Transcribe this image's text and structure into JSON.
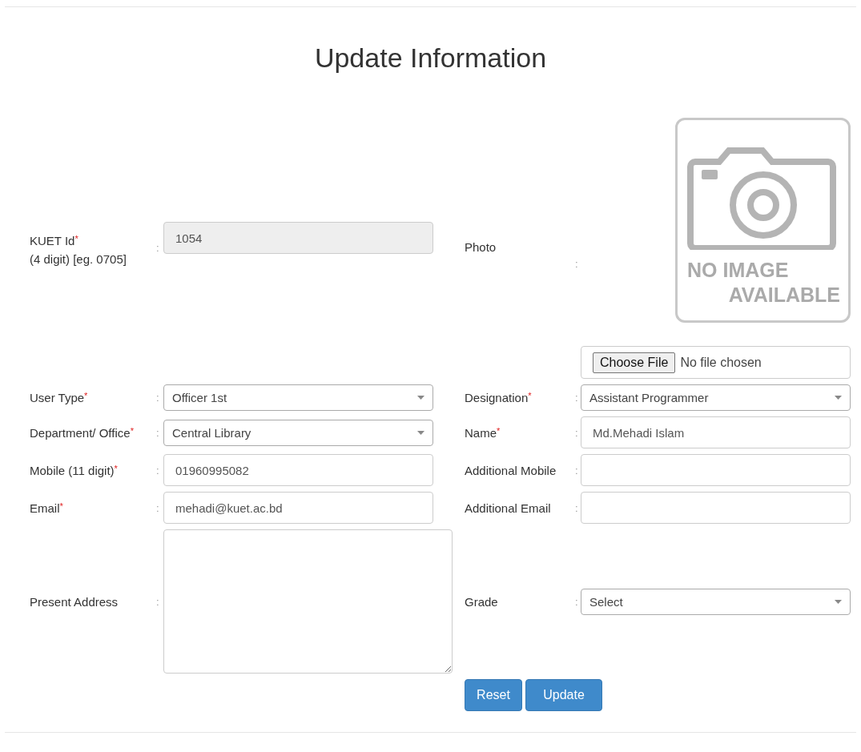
{
  "title": "Update Information",
  "rows": [
    {
      "left": {
        "kind": "text",
        "label": "KUET Id",
        "marker": "*",
        "hint": "(4 digit) [eg. 0705]",
        "separator": ":",
        "value": "1054",
        "disabled": true
      },
      "right": {
        "kind": "photo",
        "label": "Photo",
        "separator": ":",
        "image_text": [
          "NO IMAGE",
          "AVAILABLE"
        ]
      }
    },
    {
      "right": {
        "kind": "file",
        "button": "Choose File",
        "status": "No file chosen"
      }
    },
    {
      "left": {
        "kind": "select",
        "label": "User Type",
        "marker": "*",
        "separator": ":",
        "value": "Officer 1st"
      },
      "right": {
        "kind": "select",
        "label": "Designation",
        "marker": "*",
        "separator": ":",
        "value": "Assistant Programmer"
      }
    },
    {
      "left": {
        "kind": "select",
        "label": "Department/ Office",
        "marker": "*",
        "separator": ":",
        "value": "Central Library"
      },
      "right": {
        "kind": "text",
        "label": "Name",
        "marker": "*",
        "separator": ":",
        "value": "Md.Mehadi Islam",
        "disabled": false
      }
    },
    {
      "left": {
        "kind": "text",
        "label": "Mobile (11 digit)",
        "marker": "*",
        "separator": ":",
        "value": "01960995082",
        "disabled": false
      },
      "right": {
        "kind": "text",
        "label": "Additional Mobile",
        "separator": ":",
        "disabled": false
      }
    },
    {
      "left": {
        "kind": "text",
        "label": "Email",
        "marker": "*",
        "separator": ":",
        "value": "mehadi@kuet.ac.bd",
        "disabled": false
      },
      "right": {
        "kind": "text",
        "label": "Additional Email",
        "separator": ":",
        "disabled": false
      }
    },
    {
      "left": {
        "kind": "textarea",
        "label": "Present Address",
        "separator": ":"
      },
      "right": {
        "kind": "select",
        "label": "Grade",
        "separator": ":",
        "value": "Select"
      }
    },
    {
      "right": {
        "kind": "buttons",
        "buttons": [
          "Reset",
          "Update"
        ]
      }
    }
  ]
}
